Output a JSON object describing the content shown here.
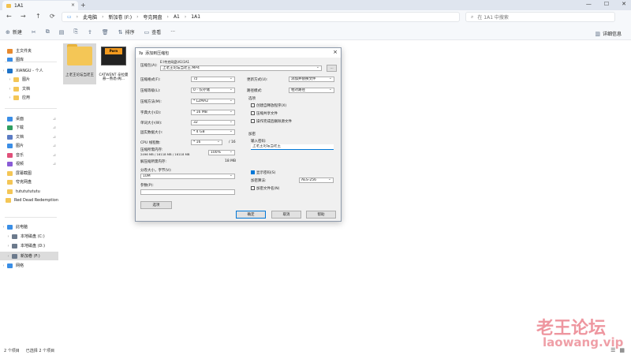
{
  "window": {
    "tab_title": "1A1",
    "tab_close": "×",
    "new_tab": "+",
    "controls": [
      "—",
      "☐",
      "✕"
    ]
  },
  "nav": {
    "back": "←",
    "forward": "→",
    "up": "↑",
    "refresh": "⟳"
  },
  "breadcrumb": [
    "此电脑",
    "新加卷 (F:)",
    "夸克网盘",
    "A1",
    "1A1"
  ],
  "search_placeholder": "在 1A1 中搜索",
  "toolbar": {
    "new": "新建",
    "sort": "排序",
    "view": "查看",
    "more": "···",
    "details": "详细信息"
  },
  "sidebar": {
    "items": [
      {
        "label": "主文件夹",
        "icon": "home-icon",
        "color": "#e88a2e"
      },
      {
        "label": "图库",
        "icon": "gallery-icon",
        "color": "#3a8ee6"
      },
      {
        "label": "XIANGU - 个人",
        "icon": "cloud-icon",
        "color": "#1e73c8"
      },
      {
        "label": "图片",
        "icon": "folder-icon",
        "color": "#f4c656"
      },
      {
        "label": "文档",
        "icon": "folder-icon",
        "color": "#f4c656"
      },
      {
        "label": "应用",
        "icon": "folder-icon",
        "color": "#f4c656"
      },
      {
        "label": "桌面",
        "icon": "desktop-icon",
        "color": "#3a8ee6"
      },
      {
        "label": "下载",
        "icon": "download-icon",
        "color": "#2f9e61"
      },
      {
        "label": "文档",
        "icon": "document-icon",
        "color": "#5b7cc4"
      },
      {
        "label": "图片",
        "icon": "picture-icon",
        "color": "#3a8ee6"
      },
      {
        "label": "音乐",
        "icon": "music-icon",
        "color": "#e0507a"
      },
      {
        "label": "视频",
        "icon": "video-icon",
        "color": "#8a5cd6"
      },
      {
        "label": "屏幕截图",
        "icon": "folder-icon",
        "color": "#f4c656"
      },
      {
        "label": "夸克网盘",
        "icon": "folder-icon",
        "color": "#f4c656"
      },
      {
        "label": "tutututututu",
        "icon": "folder-icon",
        "color": "#f4c656"
      },
      {
        "label": "Red Dead Redemption",
        "icon": "folder-icon",
        "color": "#f4c656"
      },
      {
        "label": "此电脑",
        "icon": "computer-icon",
        "color": "#3a8ee6"
      },
      {
        "label": "本地磁盘 (C:)",
        "icon": "drive-icon",
        "color": "#6c7a8c"
      },
      {
        "label": "本地磁盘 (D:)",
        "icon": "drive-icon",
        "color": "#6c7a8c"
      },
      {
        "label": "新加卷 (F:)",
        "icon": "drive-icon",
        "color": "#6c7a8c"
      },
      {
        "label": "网络",
        "icon": "network-icon",
        "color": "#3a8ee6"
      }
    ]
  },
  "files": [
    {
      "name": "上老王论坛当老王"
    },
    {
      "name": "CATWENT 辛拉曼悬一熟悉·阁...",
      "badge": "Porn"
    }
  ],
  "dialog": {
    "title": "添加到压缩包",
    "archive_name_label": "压缩包(A):",
    "archive_folder": "E:\\夸克网盘\\A1\\1A1",
    "archive_name_value": "上老王论坛当老王.MP4",
    "browse": "...",
    "format_label": "压缩格式(F):",
    "format_value": "7z",
    "level_label": "压缩等级(L):",
    "level_value": "0 - 仅存储",
    "method_label": "压缩方法(M):",
    "method_value": "* LZMA2",
    "dict_label": "字典大小(D):",
    "dict_value": "* 16 MB",
    "word_label": "单词大小(W):",
    "word_value": "32",
    "solid_label": "固实数据大小:",
    "solid_value": "* 4 GB",
    "threads_label": "CPU 线程数:",
    "threads_value": "* 16",
    "threads_total": "/ 16",
    "mem_label": "压缩所需内存:",
    "mem_detail": "2496 MB / 16118 MB / 16118 MB",
    "mem_pct": "100%",
    "decomp_label": "解压缩所需内存:",
    "decomp_value": "18 MB",
    "split_label": "分卷大小，字节(V):",
    "split_value": "10M",
    "params_label": "参数(P):",
    "options_button": "选项",
    "update_label": "更新方式(U):",
    "update_value": "添加并替换文件",
    "path_label": "路径模式:",
    "path_value": "相对路径",
    "options_group": "选项",
    "opt_sfx": "创建自释放程序(X)",
    "opt_shared": "压缩共享文件",
    "opt_delete": "操作完成后删除源文件",
    "encrypt_group": "加密",
    "password_label": "输入密码:",
    "password_value": "上老王论坛当老王",
    "show_password": "显示密码(S)",
    "enc_method_label": "加密算法:",
    "enc_method_value": "AES-256",
    "enc_names": "加密文件名(N)",
    "ok": "确定",
    "cancel": "取消",
    "help": "帮助"
  },
  "status": {
    "count": "2 个项目",
    "selected": "已选择 2 个项目"
  },
  "watermark": {
    "cn": "老王论坛",
    "url": "laowang.vip"
  }
}
